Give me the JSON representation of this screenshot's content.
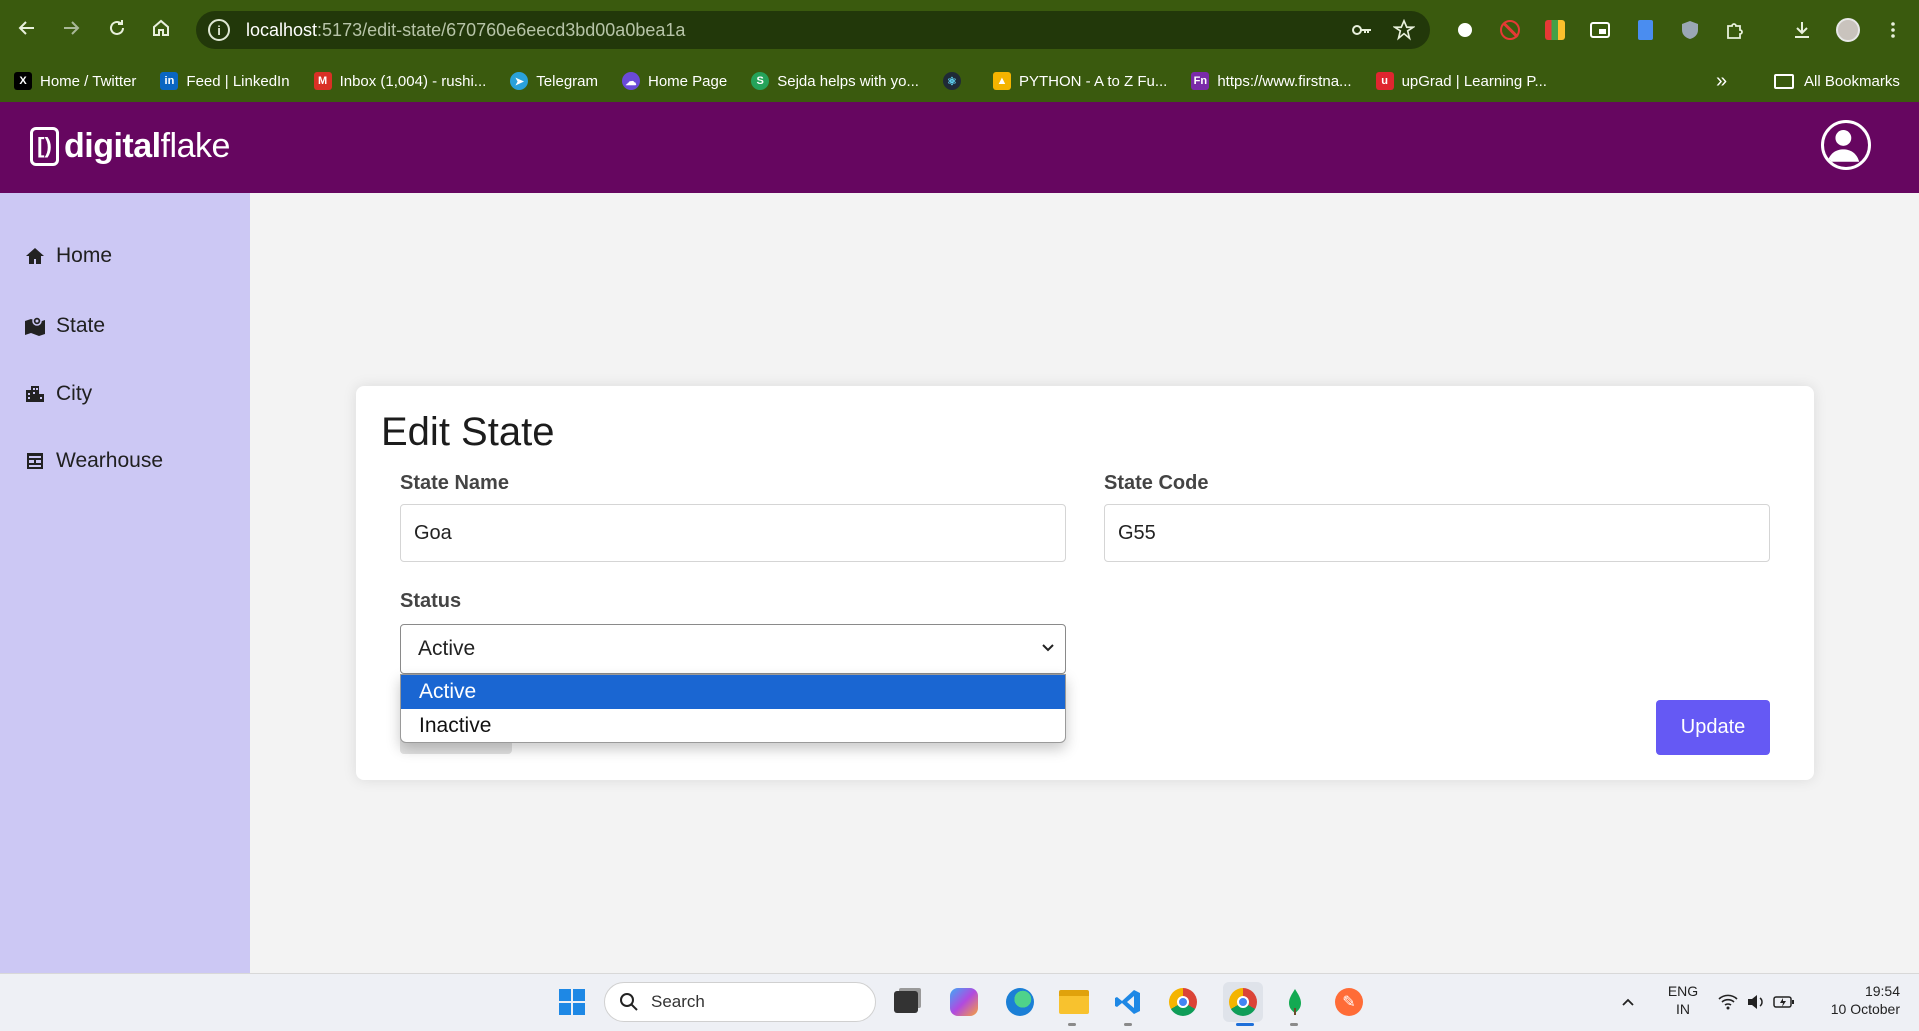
{
  "browser": {
    "url_host": "localhost",
    "url_path": ":5173/edit-state/670760e6eecd3bd00a0bea1a",
    "bookmarks": [
      {
        "label": "Home / Twitter",
        "icon": "x-icon",
        "color": "#000000"
      },
      {
        "label": "Feed | LinkedIn",
        "icon": "linkedin-icon",
        "color": "#0a66c2"
      },
      {
        "label": "Inbox (1,004) - rushi...",
        "icon": "gmail-icon",
        "color": "#d93025"
      },
      {
        "label": "Telegram",
        "icon": "telegram-icon",
        "color": "#2aa1da"
      },
      {
        "label": "Home Page",
        "icon": "cloud-icon",
        "color": "#6a4ad8"
      },
      {
        "label": "Sejda helps with yo...",
        "icon": "sejda-icon",
        "color": "#25a35a"
      },
      {
        "label": "",
        "icon": "react-icon",
        "color": "#1f2a36"
      },
      {
        "label": "PYTHON - A to Z Fu...",
        "icon": "drive-icon",
        "color": "#f4b400"
      },
      {
        "label": "https://www.firstna...",
        "icon": "fn-icon",
        "color": "#7a2aa8"
      },
      {
        "label": "upGrad | Learning P...",
        "icon": "upgrad-icon",
        "color": "#e0262f"
      }
    ],
    "all_bookmarks_label": "All Bookmarks"
  },
  "app": {
    "logo_mark": "[)",
    "logo_bold": "digital",
    "logo_light": "flake",
    "sidebar": [
      {
        "label": "Home",
        "icon": "home-icon"
      },
      {
        "label": "State",
        "icon": "map-icon"
      },
      {
        "label": "City",
        "icon": "city-icon"
      },
      {
        "label": "Wearhouse",
        "icon": "warehouse-icon"
      }
    ],
    "form": {
      "title": "Edit State",
      "state_name_label": "State Name",
      "state_name_value": "Goa",
      "state_code_label": "State Code",
      "state_code_value": "G55",
      "status_label": "Status",
      "status_value": "Active",
      "status_options": [
        "Active",
        "Inactive"
      ],
      "update_label": "Update"
    }
  },
  "taskbar": {
    "search_placeholder": "Search",
    "lang_top": "ENG",
    "lang_bottom": "IN",
    "time": "19:54",
    "date": "10 October"
  },
  "colors": {
    "header": "#660660",
    "sidebar": "#ccc8f4",
    "primary_button": "#6559f4",
    "selected_option": "#1a66d2"
  }
}
